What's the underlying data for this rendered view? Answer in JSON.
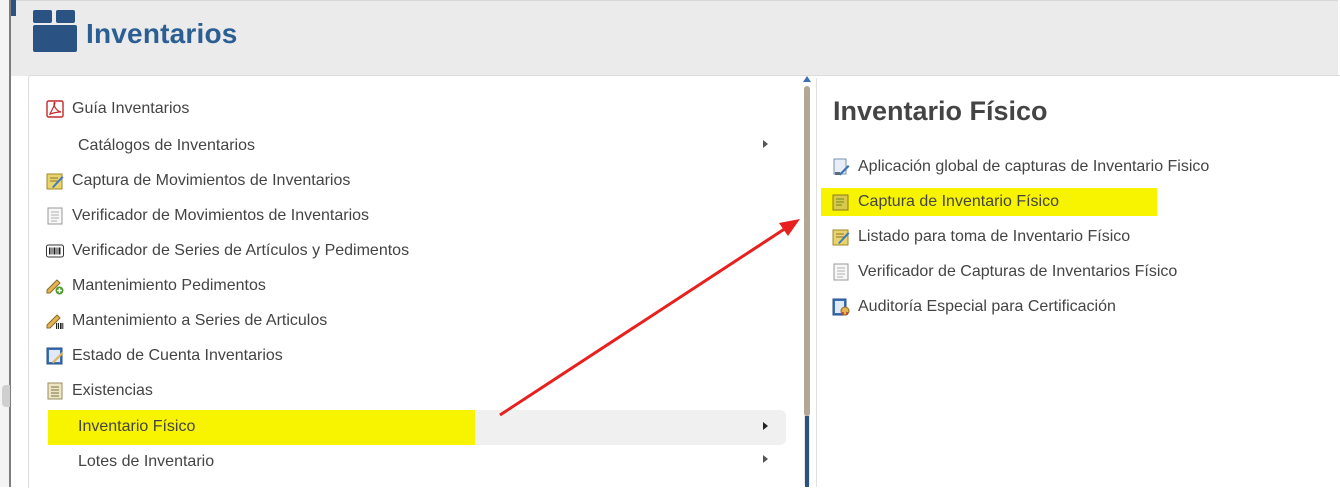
{
  "app": {
    "title": "Inventarios",
    "accent_color": "#2b5f93"
  },
  "menu": {
    "items": [
      {
        "label": "Guía Inventarios",
        "icon": "pdf-icon"
      },
      {
        "label": "Catálogos de Inventarios",
        "icon": "",
        "has_submenu": true
      },
      {
        "label": "Captura de Movimientos de Inventarios",
        "icon": "edit-form-icon"
      },
      {
        "label": "Verificador de Movimientos de Inventarios",
        "icon": "document-icon"
      },
      {
        "label": "Verificador de Series de Artículos y Pedimentos",
        "icon": "barcode-icon"
      },
      {
        "label": "Mantenimiento Pedimentos",
        "icon": "pencil-add-icon"
      },
      {
        "label": "Mantenimiento a Series de Articulos",
        "icon": "pencil-barcode-icon"
      },
      {
        "label": "Estado de Cuenta Inventarios",
        "icon": "ledger-edit-icon"
      },
      {
        "label": "Existencias",
        "icon": "list-icon"
      },
      {
        "label": "Inventario Físico",
        "icon": "",
        "has_submenu": true,
        "active": true
      },
      {
        "label": "Lotes de Inventario",
        "icon": "",
        "has_submenu": true
      }
    ]
  },
  "submenu": {
    "title": "Inventario Físico",
    "items": [
      {
        "label": "Aplicación global de capturas de Inventario Fisico",
        "icon": "document-apply-icon"
      },
      {
        "label": "Captura de Inventario Físico",
        "icon": "edit-form-icon",
        "highlighted": true
      },
      {
        "label": "Listado para toma de Inventario Físico",
        "icon": "edit-form-icon"
      },
      {
        "label": "Verificador de Capturas de Inventarios Físico",
        "icon": "document-icon"
      },
      {
        "label": "Auditoría Especial para Certificación",
        "icon": "certificate-icon"
      }
    ]
  },
  "colors": {
    "highlight": "#f8f400",
    "annotation_arrow": "#e8201e"
  }
}
